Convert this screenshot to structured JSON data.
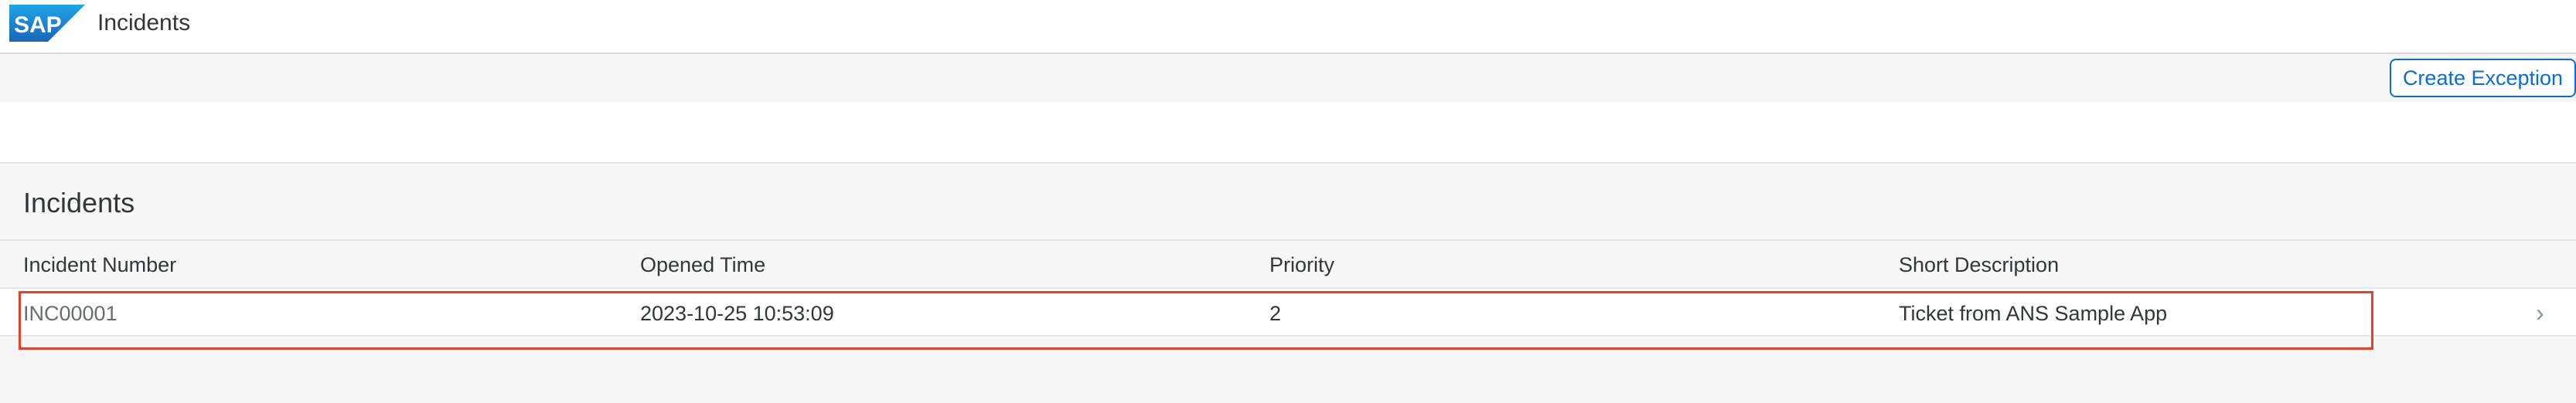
{
  "shell": {
    "logo_text": "SAP",
    "title": "Incidents"
  },
  "toolbar": {
    "create_exception_label": "Create Exception"
  },
  "table": {
    "title": "Incidents",
    "columns": [
      "Incident Number",
      "Opened Time",
      "Priority",
      "Short Description"
    ],
    "rows": [
      {
        "incident_number": "INC00001",
        "opened_time": "2023-10-25 10:53:09",
        "priority": "2",
        "short_description": "Ticket from ANS Sample App"
      }
    ]
  },
  "colors": {
    "accent": "#0a6ed1",
    "highlight": "#e8412b",
    "sap_blue": "#1b77c8"
  },
  "icons": {
    "row_navigation": "chevron-right-icon"
  }
}
